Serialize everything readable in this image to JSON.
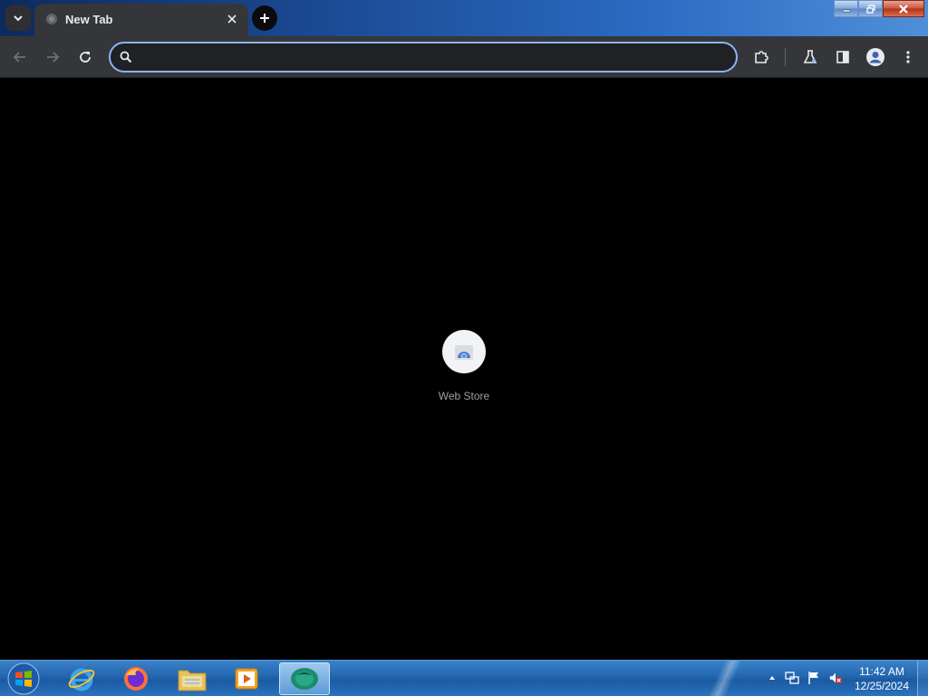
{
  "browser": {
    "tab": {
      "title": "New Tab"
    },
    "omnibox": {
      "value": "",
      "placeholder": ""
    },
    "accent_color": "#8ab4f8"
  },
  "new_tab_page": {
    "shortcuts": [
      {
        "label": "Web Store",
        "icon": "web-store-icon"
      }
    ]
  },
  "taskbar": {
    "pinned": [
      {
        "name": "internet-explorer-icon"
      },
      {
        "name": "firefox-icon"
      },
      {
        "name": "file-explorer-icon"
      },
      {
        "name": "media-player-icon"
      },
      {
        "name": "chrome-app-icon"
      }
    ],
    "clock": {
      "time": "11:42 AM",
      "date": "12/25/2024"
    }
  }
}
